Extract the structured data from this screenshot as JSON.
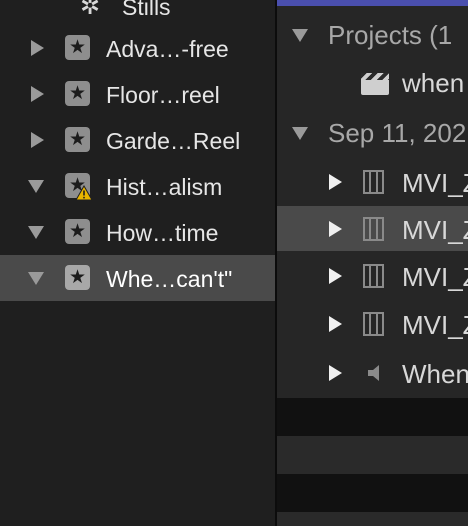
{
  "sidebar": {
    "header_partial": "Stills",
    "items": [
      {
        "label": "Adva…-free",
        "expanded": false,
        "warning": false,
        "selected": false
      },
      {
        "label": "Floor…reel",
        "expanded": false,
        "warning": false,
        "selected": false
      },
      {
        "label": "Garde…Reel",
        "expanded": false,
        "warning": false,
        "selected": false
      },
      {
        "label": "Hist…alism",
        "expanded": true,
        "warning": true,
        "selected": false
      },
      {
        "label": "How…time",
        "expanded": true,
        "warning": false,
        "selected": false
      },
      {
        "label": "Whe…can't\"",
        "expanded": true,
        "warning": false,
        "selected": true
      }
    ]
  },
  "browser": {
    "projects_group": "Projects  (1",
    "project_item": "when",
    "date_group": "Sep 11, 202",
    "clips": [
      "MVI_Z",
      "MVI_Z",
      "MVI_Z",
      "MVI_Z"
    ],
    "audio_clip": "When"
  },
  "colors": {
    "accent_bar": "#4a4fae",
    "selection": "#4a4a4a",
    "warning": "#e8b400"
  }
}
